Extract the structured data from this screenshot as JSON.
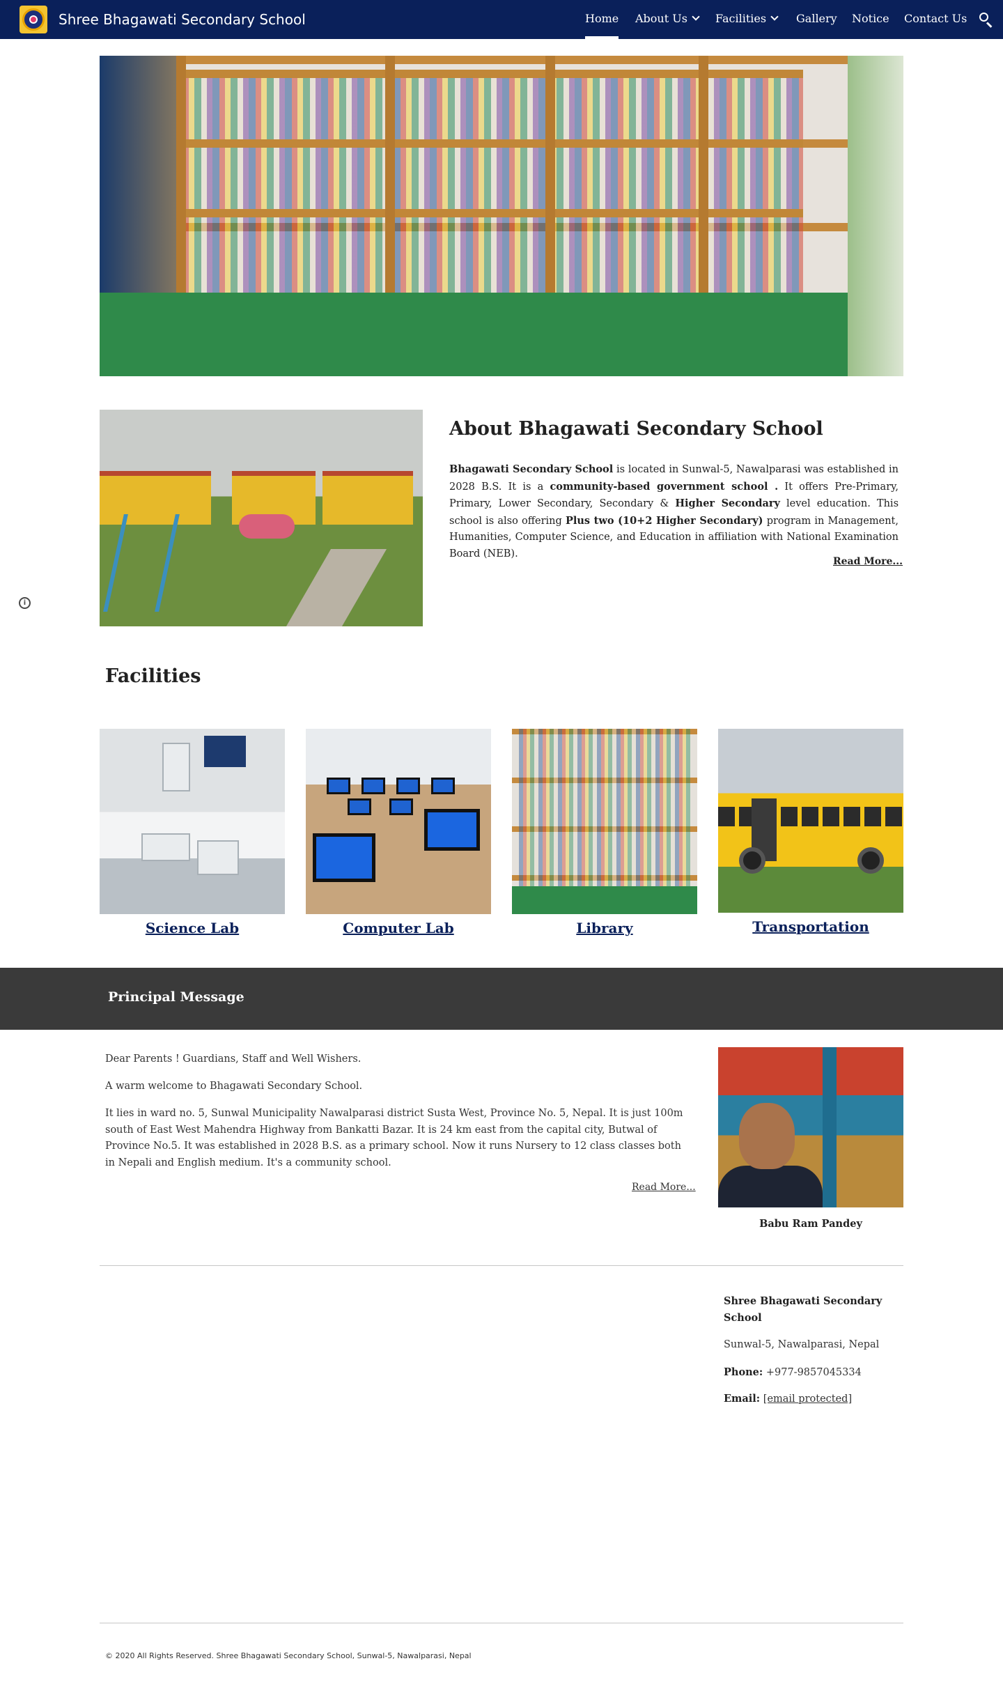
{
  "header": {
    "site_title": "Shree Bhagawati Secondary School",
    "nav": [
      {
        "label": "Home",
        "active": true,
        "has_dropdown": false
      },
      {
        "label": "About Us",
        "active": false,
        "has_dropdown": true
      },
      {
        "label": "Facilities",
        "active": false,
        "has_dropdown": true
      },
      {
        "label": "Gallery",
        "active": false,
        "has_dropdown": false
      },
      {
        "label": "Notice",
        "active": false,
        "has_dropdown": false
      },
      {
        "label": "Contact Us",
        "active": false,
        "has_dropdown": false
      }
    ],
    "search_icon": "search-icon",
    "colors": {
      "bar": "#0a205a",
      "text": "#ffffff"
    }
  },
  "about": {
    "heading": "About Bhagawati Secondary School",
    "p1_bold": "Bhagawati Secondary School",
    "p1_a": " is located in Sunwal-5, Nawalparasi was established in 2028 B.S. It is a ",
    "p1_bold2": "community-based government school .",
    "p1_b": " It offers Pre-Primary, Primary, Lower Secondary, Secondary & ",
    "p1_bold3": "Higher Secondary",
    "p1_c": " level education. This school is also offering ",
    "p1_bold4": "Plus two (10+2 Higher Secondary)",
    "p1_d": " program in Management, Humanities, Computer Science, and Education in affiliation with National Examination Board (NEB).",
    "read_more": "Read More..."
  },
  "facilities": {
    "heading": "Facilities",
    "items": [
      {
        "label": "Science Lab"
      },
      {
        "label": "Computer Lab"
      },
      {
        "label": "Library"
      },
      {
        "label": "Transportation"
      }
    ]
  },
  "principal": {
    "band_title": "Principal Message",
    "greeting": "Dear Parents ! Guardians, Staff and Well Wishers.",
    "welcome": "A warm welcome to Bhagawati Secondary School.",
    "body": "It lies in ward no. 5, Sunwal Municipality Nawalparasi district Susta West, Province No. 5, Nepal. It is just 100m south of East West Mahendra Highway from Bankatti Bazar. It is 24 km east from the capital city, Butwal of Province No.5. It was established in 2028 B.S. as a primary school. Now it runs Nursery to 12 class classes both in Nepali and English medium. It's a community school.",
    "read_more": "Read More...",
    "name": "Babu Ram Pandey"
  },
  "contact": {
    "school_name": "Shree Bhagawati Secondary School",
    "address": "Sunwal-5, Nawalparasi, Nepal",
    "phone_label": "Phone:",
    "phone": " +977-9857045334",
    "email_label": "Email:",
    "email": "[email protected]"
  },
  "footer": {
    "copyright": "©  2020 All Rights Reserved. Shree Bhagawati Secondary School, Sunwal-5, Nawalparasi, Nepal"
  }
}
